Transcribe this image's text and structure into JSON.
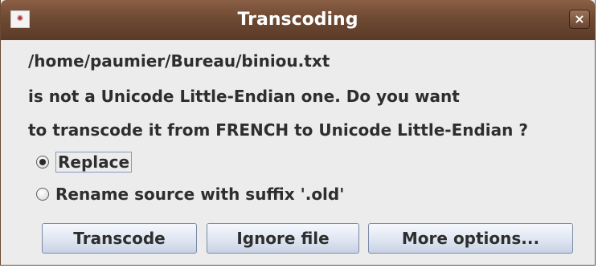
{
  "window": {
    "title": "Transcoding",
    "icon": "app-icon",
    "close_label": "×"
  },
  "message": {
    "line1": "/home/paumier/Bureau/biniou.txt",
    "line2": "is not a Unicode Little-Endian one. Do you want",
    "line3": "to transcode it from FRENCH to Unicode Little-Endian ?"
  },
  "options": [
    {
      "label": "Replace",
      "selected": true
    },
    {
      "label": "Rename source with suffix '.old'",
      "selected": false
    }
  ],
  "buttons": {
    "transcode": "Transcode",
    "ignore": "Ignore file",
    "more": "More options..."
  },
  "colors": {
    "titlebar": "#6f4a33",
    "dialog_bg": "#ececec",
    "button_border": "#7a8aa6"
  }
}
